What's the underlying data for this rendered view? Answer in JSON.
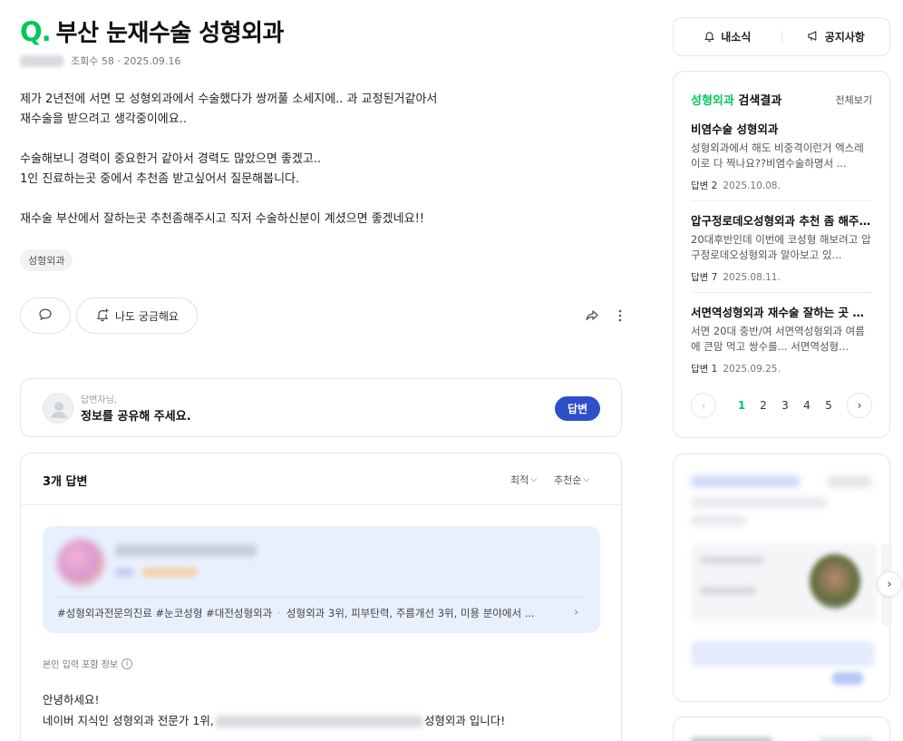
{
  "question": {
    "mark": "Q.",
    "title": "부산 눈재수술 성형외과",
    "views": "조회수 58 · 2025.09.16",
    "body": [
      "제가 2년전에 서면 모 성형외과에서 수술했다가 쌍꺼풀 소세지에.. 과 교정된거같아서",
      "재수술을 받으려고 생각중이에요..",
      "",
      "수술해보니 경력이 중요한거 같아서 경력도 많았으면 좋겠고..",
      "1인 진료하는곳 중에서 추천좀 받고싶어서 질문해봅니다.",
      "",
      "재수술 부산에서 잘하는곳 추천좀해주시고 직저 수술하신분이 계셨으면 좋겠네요!!"
    ],
    "tag": "성형외과",
    "curious_label": "나도 궁금해요"
  },
  "answer_prompt": {
    "hint": "답변자님,",
    "main": "정보를 공유해 주세요.",
    "button": "답변"
  },
  "answers": {
    "count_label": "3개 답변",
    "sort_latest": "최적",
    "sort_recommended": "추천순",
    "expert_tags": "#성형외과전문의진료 #눈코성형 #대전성형외과",
    "expert_ranks": "성형외과 3위, 피부탄력, 주름개선 3위, 미용 분야에서 ...",
    "self_info": "본인 입력 포함 정보",
    "greeting": "안녕하세요!",
    "intro_prefix": "네이버 지식인 성형외과 전문가 1위,",
    "intro_suffix": "성형외과 입니다!"
  },
  "sidebar": {
    "news": "내소식",
    "notice": "공지사항",
    "search": {
      "keyword": "성형외과",
      "title_suffix": " 검색결과",
      "all": "전체보기",
      "items": [
        {
          "title": "비염수술 성형외과",
          "desc": "성형외과에서 해도 비중격이런거 엑스레이로 다 찍나요??비염수술하명서 ...",
          "answers": "답변 2",
          "date": "2025.10.08."
        },
        {
          "title": "압구정로데오성형외과 추천 좀 해주세요",
          "desc": "20대후반인데 이번에 코성형 해보려고 압구정로데오성형외과 알아보고 있...",
          "answers": "답변 7",
          "date": "2025.08.11."
        },
        {
          "title": "서면역성형외과 재수술 잘하는 곳 있을까요",
          "desc": "서면 20대 중반/여 서면역성형외과 여름에 큰맘 먹고 쌍수를... 서면역성형...",
          "answers": "답변 1",
          "date": "2025.09.25."
        }
      ],
      "pages": [
        "1",
        "2",
        "3",
        "4",
        "5"
      ]
    }
  },
  "icons": {
    "comment": "comment-icon",
    "curious": "bell-plus-icon",
    "share": "share-icon",
    "more": "more-vertical-icon",
    "bell": "bell-icon",
    "megaphone": "megaphone-icon"
  },
  "colors": {
    "accent_green": "#03c75a",
    "answer_button": "#2d4fc7",
    "expert_card_bg": "#e9f0fd"
  }
}
